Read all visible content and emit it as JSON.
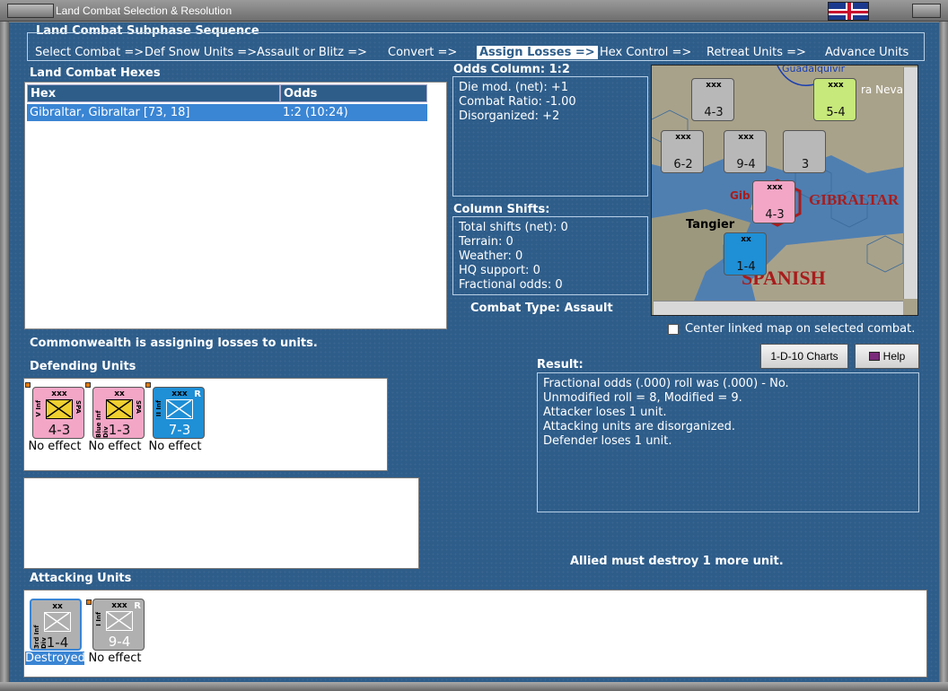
{
  "window": {
    "title": "Land Combat Selection & Resolution"
  },
  "subphase": {
    "header": "Land Combat Subphase Sequence",
    "steps": [
      {
        "label": "Select Combat =>"
      },
      {
        "label": "Def Snow Units =>"
      },
      {
        "label": "Assault or Blitz =>"
      },
      {
        "label": "Convert =>"
      },
      {
        "label": "Assign Losses =>"
      },
      {
        "label": "Hex Control =>"
      },
      {
        "label": "Retreat Units =>"
      },
      {
        "label": "Advance Units"
      }
    ],
    "active_step": "Assign Losses =>"
  },
  "hexes": {
    "header": "Land Combat Hexes",
    "columns": [
      "Hex",
      "Odds"
    ],
    "rows": [
      {
        "hex": "Gibraltar, Gibraltar [73, 18]",
        "odds": "1:2 (10:24)"
      }
    ]
  },
  "odds": {
    "header": "Odds Column: 1:2",
    "lines": [
      "Die mod. (net): +1",
      "Combat Ratio: -1.00",
      "Disorganized: +2"
    ]
  },
  "shifts": {
    "header": "Column Shifts:",
    "lines": [
      "Total shifts (net): 0",
      "Terrain: 0",
      "Weather: 0",
      "HQ support: 0",
      "Fractional odds: 0"
    ]
  },
  "combat_type": "Combat Type:  Assault",
  "map": {
    "labels": {
      "gibraltar": "GIBRALTAR",
      "tangier": "Tangier",
      "spanish": "SPANISH",
      "sierra": "ra Nevad",
      "guad": "Guadalquivir",
      "gib": "Gib"
    },
    "counters": [
      {
        "str": "4-3",
        "size": "xxx"
      },
      {
        "str": "5-4",
        "size": "xxx"
      },
      {
        "str": "6-2",
        "size": "xxx"
      },
      {
        "str": "9-4",
        "size": "xxx"
      },
      {
        "str": "3",
        "size": ""
      },
      {
        "str": "4-3",
        "size": "xxx"
      },
      {
        "str": "1-4",
        "size": "xx"
      }
    ]
  },
  "center_map_label": "Center linked map on selected combat.",
  "buttons": {
    "charts": "1-D-10 Charts",
    "help": "Help"
  },
  "status_message": "Commonwealth is assigning losses to units.",
  "defending": {
    "header": "Defending Units",
    "units": [
      {
        "size": "xxx",
        "str": "4-3",
        "side": "V Inf",
        "nat": "SPA",
        "status": "No effect",
        "color": "#f3a6c6"
      },
      {
        "size": "xx",
        "str": "1-3",
        "side": "Blue Inf Div",
        "nat": "SPA",
        "status": "No effect",
        "color": "#f3a6c6"
      },
      {
        "size": "xxx",
        "str": "7-3",
        "side": "II Inf",
        "nat": "",
        "tag": "R",
        "status": "No effect",
        "color": "#1f8fd6"
      }
    ]
  },
  "result": {
    "header": "Result:",
    "lines": [
      "Fractional odds (.000) roll was (.000)  - No.",
      "Unmodified roll = 8, Modified = 9.",
      "Attacker loses 1 unit.",
      "Attacking units are disorganized.",
      "Defender loses 1 unit."
    ]
  },
  "allied_message": "Allied must destroy 1 more unit.",
  "attacking": {
    "header": "Attacking Units",
    "units": [
      {
        "size": "xx",
        "str": "1-4",
        "side": "3rd Inf Div",
        "status": "Destroyed",
        "color": "#b0b0b0"
      },
      {
        "size": "xxx",
        "str": "9-4",
        "side": "I Inf",
        "tag": "R",
        "status": "No effect",
        "color": "#b0b0b0"
      }
    ]
  },
  "colors": {
    "panel_bg": "#2e5d8a",
    "selected_row": "#3a85d4",
    "spanish": "#f3a6c6",
    "french": "#1f8fd6",
    "commonwealth": "#b0b0b0"
  }
}
